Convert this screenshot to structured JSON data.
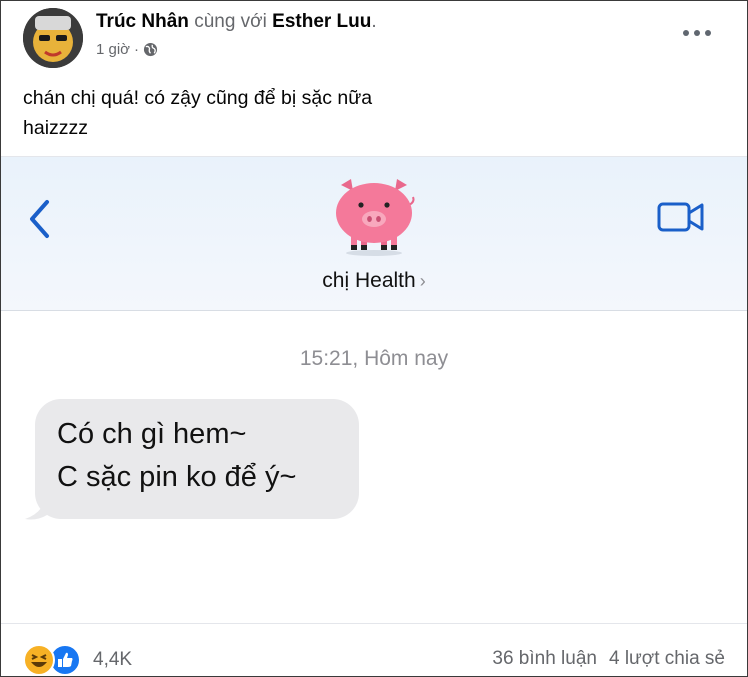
{
  "post": {
    "author": "Trúc Nhân",
    "with_text": "cùng với",
    "tagged": "Esther Luu",
    "period": ".",
    "time": "1 giờ",
    "separator": "·",
    "privacy_icon": "globe-icon",
    "caption": "chán chị quá! có zậy cũng để bị sặc nữa\nhaizzzz",
    "more_icon": "more-options-icon"
  },
  "screenshot": {
    "back_icon": "back-chevron-icon",
    "contact_avatar_icon": "pig-avatar-icon",
    "contact_name": "chị Health",
    "contact_chevron": "›",
    "video_icon": "video-call-icon",
    "timestamp": "15:21, Hôm nay",
    "messages": [
      {
        "lines": [
          "Có ch gì hem~",
          "C sặc pin ko để ý~"
        ]
      }
    ]
  },
  "footer": {
    "reaction_icons": [
      "haha-icon",
      "like-icon"
    ],
    "reaction_count": "4,4K",
    "comments": "36 bình luận",
    "shares": "4 lượt chia sẻ"
  },
  "colors": {
    "like": "#1877f2",
    "haha": "#f7b125",
    "ios_blue": "#1a5fc9",
    "bubble": "#e9e9eb",
    "pig": "#f4799a"
  }
}
